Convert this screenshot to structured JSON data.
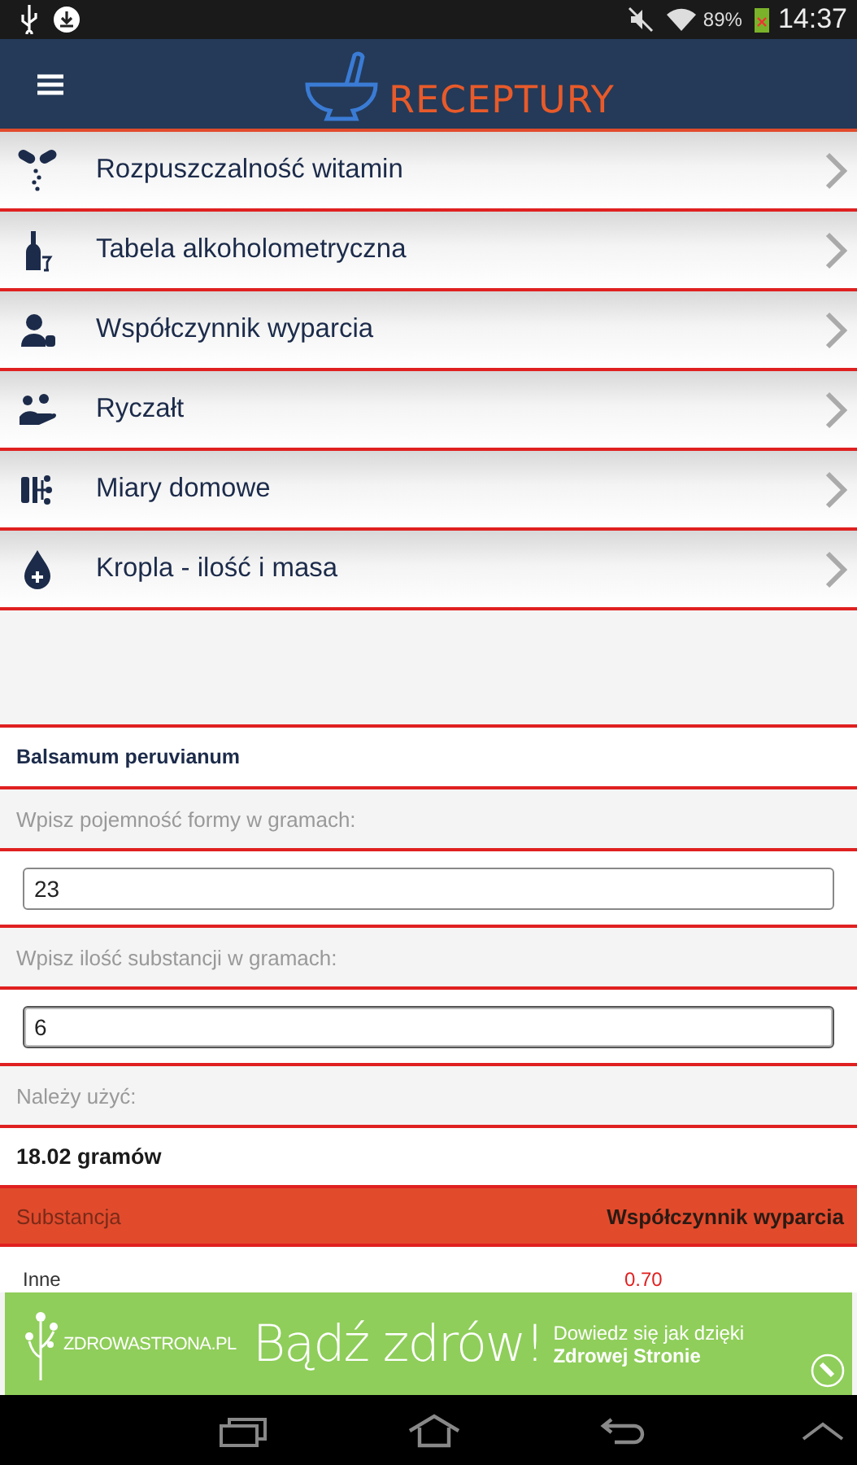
{
  "status_bar": {
    "battery": "89%",
    "time": "14:37"
  },
  "app_bar": {
    "title": "RECEPTURY"
  },
  "menu": [
    {
      "label": "Rozpuszczalność witamin"
    },
    {
      "label": "Tabela alkoholometryczna"
    },
    {
      "label": "Współczynnik wyparcia"
    },
    {
      "label": "Ryczałt"
    },
    {
      "label": "Miary domowe"
    },
    {
      "label": "Kropla - ilość i masa"
    }
  ],
  "form": {
    "substance": "Balsamum peruvianum",
    "fields": [
      {
        "label": "Wpisz pojemność formy w gramach:",
        "value": "23",
        "focused": false
      },
      {
        "label": "Wpisz ilość substancji w gramach:",
        "value": "6",
        "focused": true
      }
    ],
    "result_label": "Należy użyć:",
    "result": "18.02 gramów"
  },
  "table": {
    "columns": [
      "Substancja",
      "Współczynnik wyparcia"
    ],
    "rows": [
      [
        "Inne",
        "0.70"
      ]
    ]
  },
  "ad": {
    "logo": "ZDROWASTRONA.PL",
    "headline": "Bądź zdrów!",
    "line_1": "Dowiedz się jak dzięki",
    "line_2": "Zdrowej Stronie"
  }
}
